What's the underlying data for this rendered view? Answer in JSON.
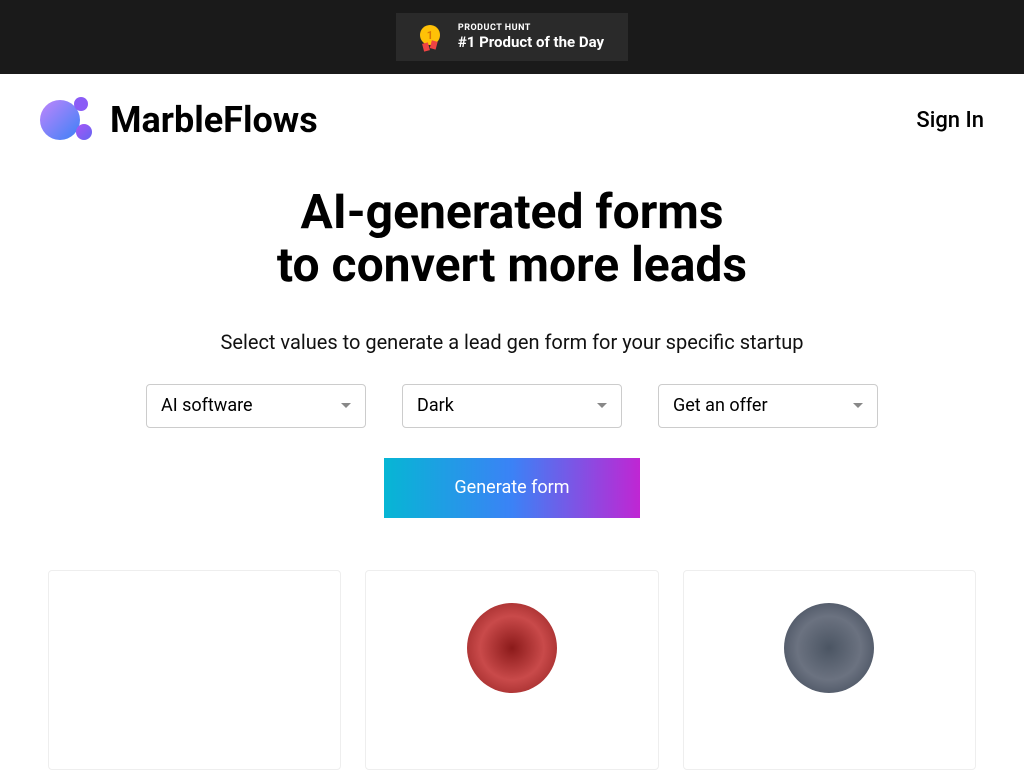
{
  "banner": {
    "label": "PRODUCT HUNT",
    "title": "#1 Product of the Day",
    "medal_number": "1"
  },
  "nav": {
    "brand": "MarbleFlows",
    "signin": "Sign In"
  },
  "hero": {
    "headline_line1": "AI-generated forms",
    "headline_line2": "to convert more leads",
    "subheadline": "Select values to generate a lead gen form for your specific startup"
  },
  "selects": {
    "category": {
      "value": "AI software"
    },
    "theme": {
      "value": "Dark"
    },
    "goal": {
      "value": "Get an offer"
    }
  },
  "cta": {
    "generate": "Generate form"
  }
}
